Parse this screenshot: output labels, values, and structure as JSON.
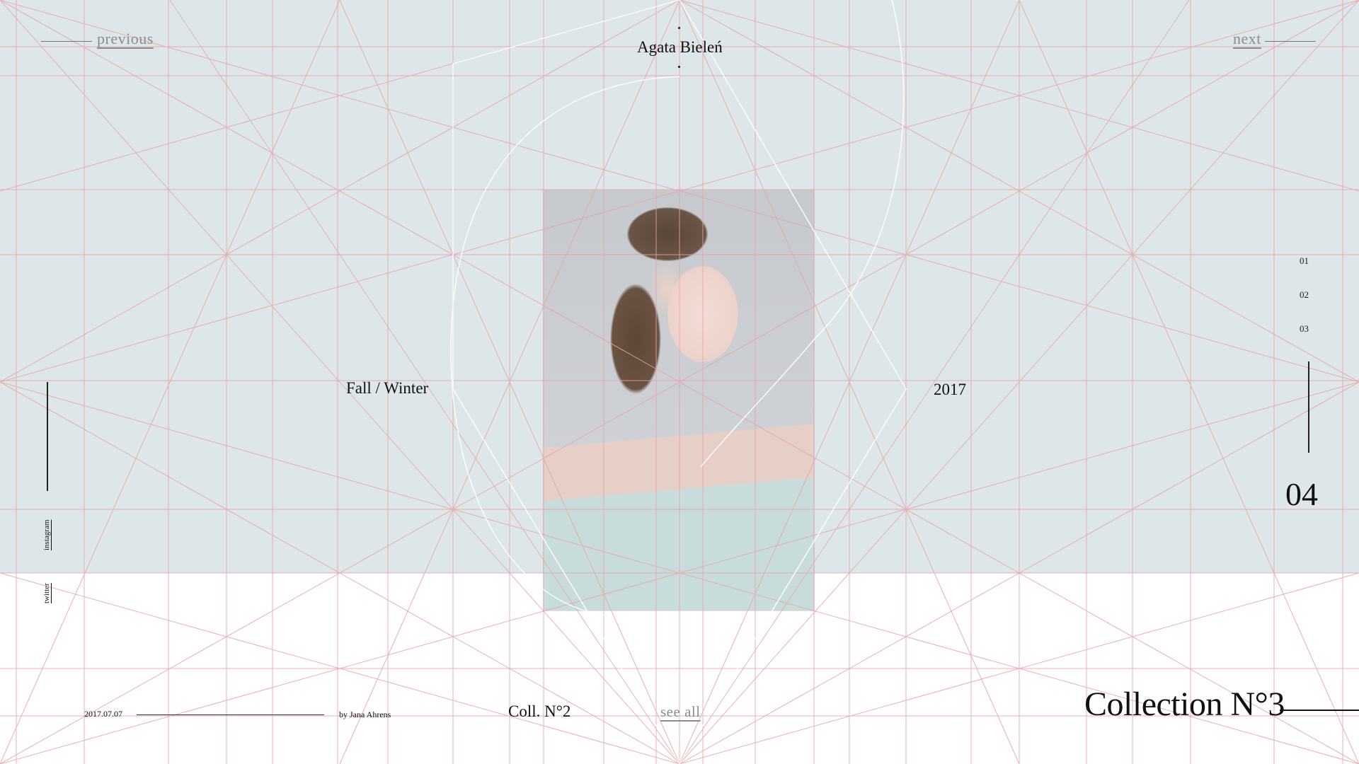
{
  "header": {
    "previous_label": "previous",
    "next_label": "next",
    "designer_name": "Agata Bieleń"
  },
  "hero": {
    "season": "Fall / Winter",
    "year": "2017",
    "photo_alt": "portrait of model"
  },
  "pager": {
    "items": [
      "01",
      "02",
      "03"
    ],
    "current": "04"
  },
  "social": {
    "instagram": "instagram",
    "twitter": "twitter"
  },
  "footer": {
    "date": "2017.07.07",
    "author": "by Jana Ahrens",
    "prev_collection": "Coll. N°2",
    "see_all": "see all",
    "collection_title": "Collection N°3"
  },
  "colors": {
    "top_band": "#dde6e9",
    "grid_lines": "#e8a3a8",
    "link_gray": "#8c8c8c"
  }
}
